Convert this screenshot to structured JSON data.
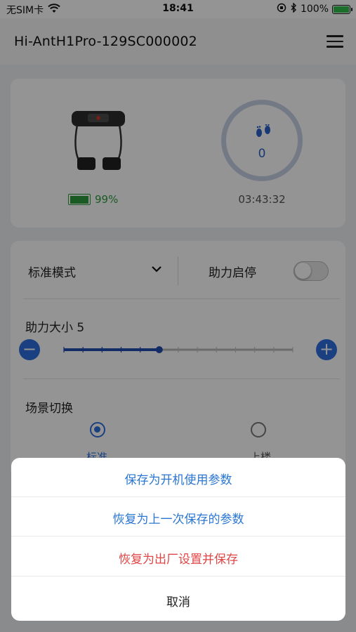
{
  "status_bar": {
    "carrier": "无SIM卡",
    "time": "18:41",
    "battery": "100%"
  },
  "header": {
    "title": "Hi-AntH1Pro-129SC000002"
  },
  "device": {
    "battery_percent": "99%",
    "battery_level": 0.99,
    "step_count": "0",
    "elapsed_time": "03:43:32"
  },
  "controls": {
    "mode_value": "标准模式",
    "assist_toggle_label": "助力启停",
    "assist_enabled": false,
    "strength_label": "助力大小 5",
    "strength_value": 5,
    "strength_max": 12,
    "scene_label": "场景切换",
    "scene_options": [
      "标准",
      "上楼"
    ],
    "scene_selected": "标准"
  },
  "action_sheet": {
    "items": [
      {
        "label": "保存为开机使用参数",
        "color": "#2a76d2"
      },
      {
        "label": "恢复为上一次保存的参数",
        "color": "#2a76d2"
      },
      {
        "label": "恢复为出厂设置并保存",
        "color": "#e04545"
      }
    ],
    "cancel_label": "取消"
  },
  "colors": {
    "accent": "#2f6fe0",
    "battery_green": "#2e9e3e",
    "destructive": "#e04545"
  }
}
